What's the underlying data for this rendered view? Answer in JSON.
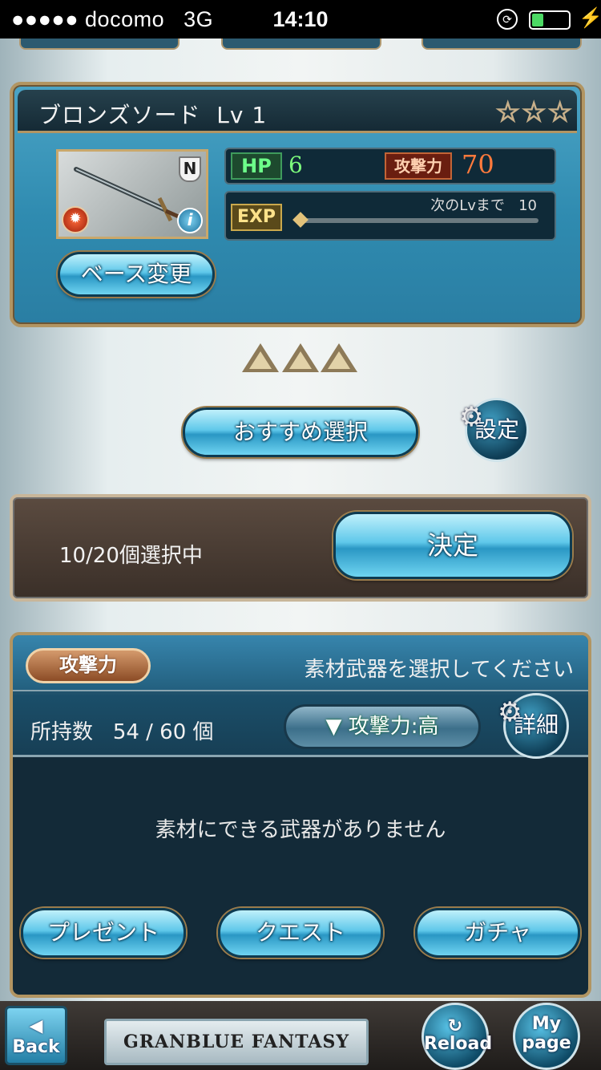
{
  "status_bar": {
    "carrier": "●●●●● docomo",
    "network": "3G",
    "time": "14:10"
  },
  "weapon": {
    "name": "ブロンズソード",
    "level": "Lv 1",
    "stars": "☆☆☆",
    "rarity": "N",
    "hp_label": "HP",
    "hp_value": "6",
    "atk_label": "攻撃力",
    "atk_value": "70",
    "exp_label": "EXP",
    "next_level_label": "次のLvまで",
    "next_level_value": "10",
    "exp_progress": 0.0
  },
  "base_change_button": "ベース変更",
  "recommend_button": "おすすめ選択",
  "settings_button": "設定",
  "selection": {
    "count_text": "10/20個選択中",
    "decide_button": "決定"
  },
  "materials": {
    "sort_badge": "攻撃力",
    "prompt": "素材武器を選択してください",
    "owned_label": "所持数",
    "owned_value": "54 / 60 個",
    "sort_dropdown": "▼ 攻撃力:高",
    "detail_button": "詳細",
    "empty_message": "素材にできる武器がありません",
    "footer_buttons": [
      "プレゼント",
      "クエスト",
      "ガチャ"
    ]
  },
  "bottom_bar": {
    "back_label": "Back",
    "logo_text": "GRANBLUE FANTASY",
    "reload_label": "Reload",
    "mypage_label_1": "My",
    "mypage_label_2": "page"
  }
}
